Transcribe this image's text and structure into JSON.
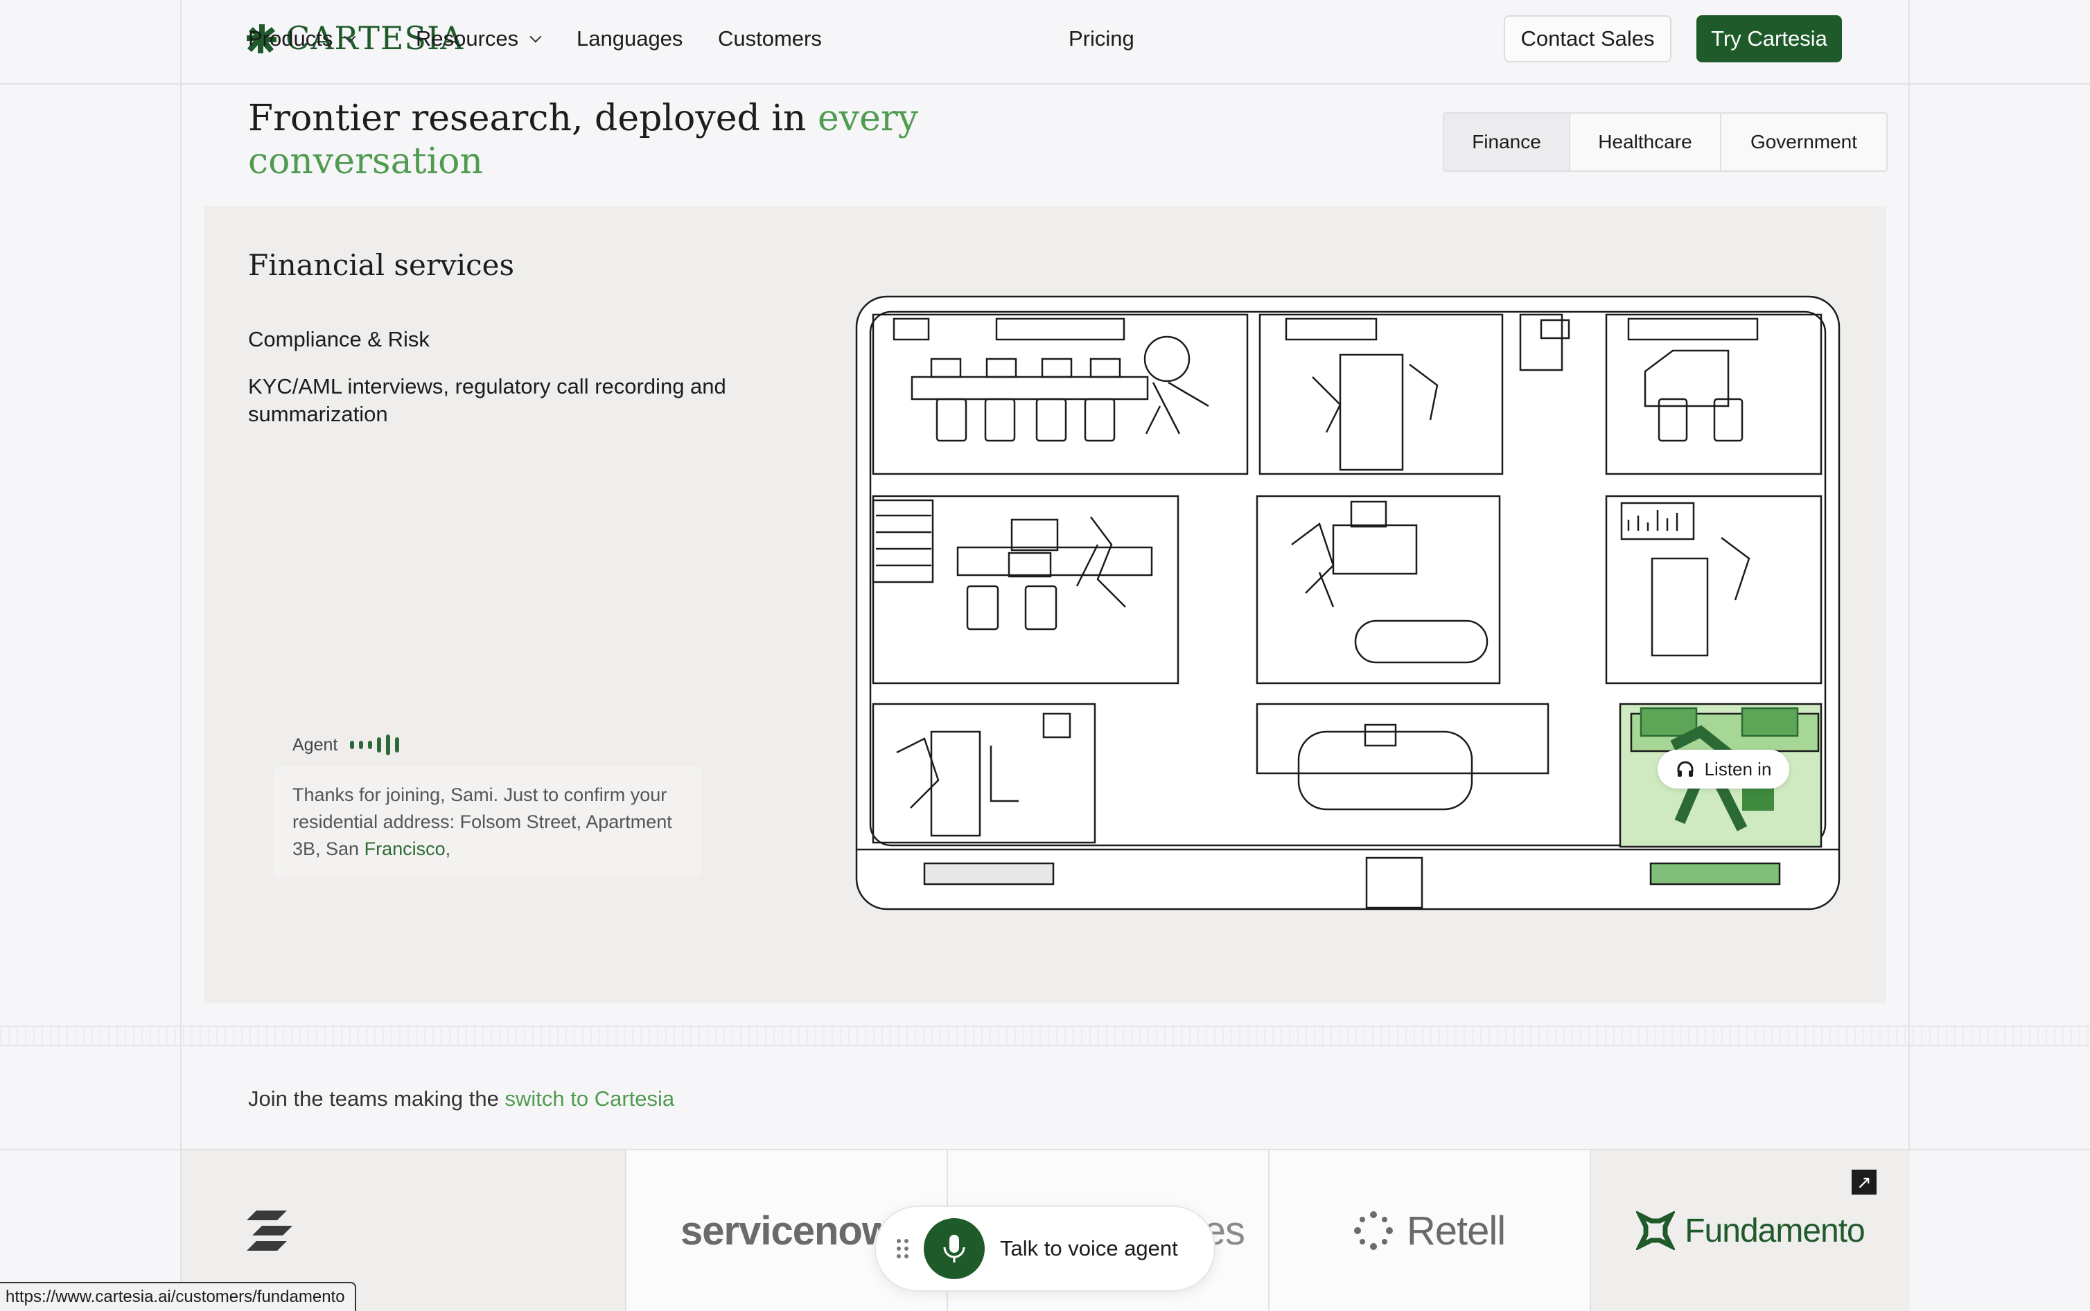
{
  "nav": {
    "brand": "CARTESIA",
    "items": [
      {
        "label": "Products",
        "dropdown": true
      },
      {
        "label": "Resources",
        "dropdown": true
      },
      {
        "label": "Languages",
        "dropdown": false
      },
      {
        "label": "Customers",
        "dropdown": false
      },
      {
        "label": "Pricing",
        "dropdown": false
      }
    ],
    "contact_label": "Contact Sales",
    "try_label": "Try Cartesia"
  },
  "hero": {
    "title_main": "Frontier research, deployed in",
    "title_accent": "every conversation"
  },
  "tabs": [
    {
      "label": "Finance",
      "active": true
    },
    {
      "label": "Healthcare",
      "active": false
    },
    {
      "label": "Government",
      "active": false
    }
  ],
  "panel": {
    "title": "Financial services",
    "subtitle": "Compliance & Risk",
    "description": "KYC/AML interviews, regulatory call recording and summarization",
    "agent_label": "Agent",
    "transcript_main": "Thanks for joining, Sami. Just to confirm your residential address: Folsom Street, Apartment 3B, San",
    "transcript_highlight": "Francisco",
    "transcript_tail": ",",
    "listen_label": "Listen in"
  },
  "join": {
    "text": "Join the teams making the",
    "accent": "switch to Cartesia"
  },
  "logos": [
    "servicenow",
    "es",
    "Retell",
    "Fundamento"
  ],
  "talk_label": "Talk to voice agent",
  "status_url": "https://www.cartesia.ai/customers/fundamento",
  "colors": {
    "brand_green": "#1f5a2b",
    "accent_green": "#4f9b50",
    "panel_bg": "#efeeed",
    "page_bg": "#f6f5f7"
  }
}
